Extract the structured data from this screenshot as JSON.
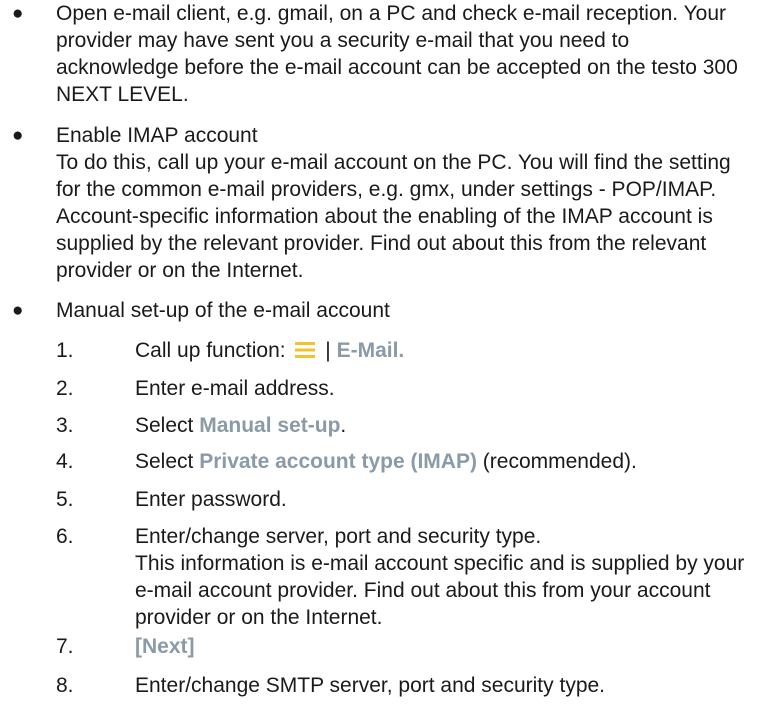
{
  "bullets": [
    {
      "text": "Open e-mail client, e.g. gmail, on a PC and check e-mail reception. Your provider may have sent you a security e-mail that you need to acknowledge before the e-mail account can be accepted on the testo 300 NEXT LEVEL."
    },
    {
      "title": "Enable IMAP account",
      "text": "To do this, call up your e-mail account on the PC. You will find the setting for the common e-mail providers, e.g. gmx, under settings - POP/IMAP. Account-specific information about the enabling of the IMAP account is supplied by the relevant provider. Find out about this from the relevant provider or on the Internet."
    },
    {
      "title": "Manual set-up of the e-mail account"
    }
  ],
  "steps": [
    {
      "num": "1.",
      "pre": "Call up function:",
      "sep": "|",
      "term": "E-Mail.",
      "icon": "menu-icon"
    },
    {
      "num": "2.",
      "text": "Enter e-mail address."
    },
    {
      "num": "3.",
      "pre": "Select",
      "term": "Manual set-up",
      "post": "."
    },
    {
      "num": "4.",
      "pre": "Select",
      "term": "Private account type (IMAP)",
      "post": "(recommended)."
    },
    {
      "num": "5.",
      "text": "Enter password."
    },
    {
      "num": "6.",
      "text": "Enter/change server, port and security type.",
      "note": "This information is e-mail account specific and is supplied by your e-mail account provider. Find out about this from your account provider or on the Internet."
    },
    {
      "num": "7.",
      "term": "[Next]"
    },
    {
      "num": "8.",
      "text": "Enter/change SMTP server, port and security type."
    }
  ],
  "colors": {
    "ui_term": "#8a9aa6",
    "icon": "#f2c230",
    "text": "#1a1a1a"
  }
}
